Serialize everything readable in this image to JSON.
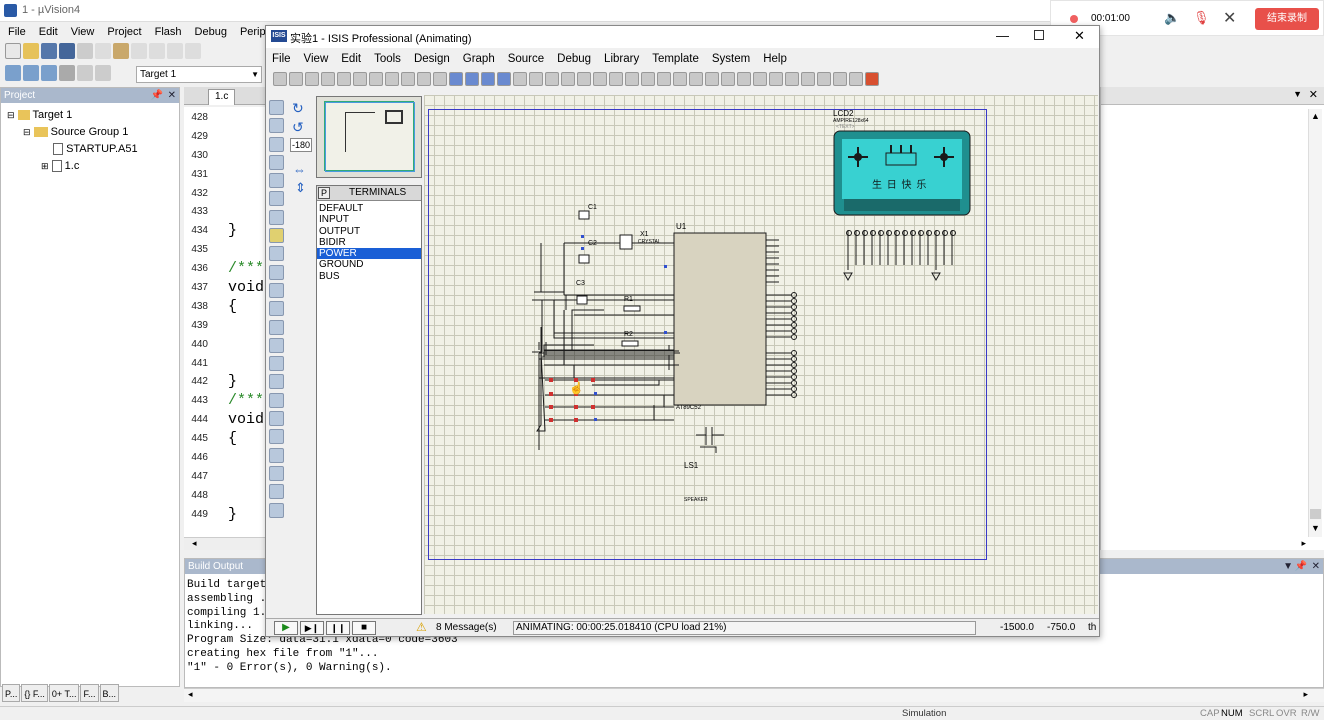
{
  "keil": {
    "title": "1 - µVision4",
    "menu": [
      "File",
      "Edit",
      "View",
      "Project",
      "Flash",
      "Debug",
      "Peripherals"
    ],
    "target_select": "Target 1",
    "project_title": "Project",
    "tree": [
      "Target 1",
      "Source Group 1",
      "STARTUP.A51",
      "1.c"
    ],
    "file_tab": "1.c",
    "line_numbers": [
      "428",
      "429",
      "430",
      "431",
      "432",
      "433",
      "434",
      "435",
      "436",
      "437",
      "438",
      "439",
      "440",
      "441",
      "442",
      "443",
      "444",
      "445",
      "446",
      "447",
      "448",
      "449"
    ],
    "code_lines": [
      "",
      "",
      "",
      "",
      "",
      "",
      "}",
      "",
      "/***",
      "void",
      "{",
      "",
      "",
      "",
      "}",
      "/***",
      "void",
      "{",
      "",
      "",
      "",
      "}"
    ],
    "build_output_title": "Build Output",
    "build_output": [
      "Build target",
      "assembling ...",
      "compiling 1.c...",
      "linking...",
      "Program Size: data=31.1 xdata=0 code=3603",
      "creating hex file from \"1\"...",
      "\"1\" - 0 Error(s), 0 Warning(s)."
    ],
    "bottom_tabs": [
      "P...",
      "{} F...",
      "0+ T...",
      "F...",
      "B..."
    ],
    "status": {
      "mode": "Simulation",
      "flags": [
        "CAP",
        "NUM",
        "SCRL",
        "OVR",
        "R/W"
      ]
    }
  },
  "recorder": {
    "time": "00:01:00",
    "end_label": "结束录制"
  },
  "isis": {
    "title": "实验1 - ISIS Professional (Animating)",
    "logo": "ISIS",
    "menu": [
      "File",
      "View",
      "Edit",
      "Tools",
      "Design",
      "Graph",
      "Source",
      "Debug",
      "Library",
      "Template",
      "System",
      "Help"
    ],
    "rotation": "-180",
    "selector_p": "P",
    "selector_title": "TERMINALS",
    "terminals": [
      "DEFAULT",
      "INPUT",
      "OUTPUT",
      "BIDIR",
      "POWER",
      "GROUND",
      "BUS"
    ],
    "selected_terminal": "POWER",
    "messages": "8 Message(s)",
    "anim_status": "ANIMATING: 00:00:25.018410 (CPU load 21%)",
    "coord_x": "-1500.0",
    "coord_y": "-750.0",
    "units": "th",
    "components": {
      "lcd": "LCD2",
      "lcd_model": "AMPIRE128x64",
      "lcd_text": "生 日 快 乐",
      "u1": "U1",
      "u1_model": "AT89C52",
      "x1": "X1",
      "x1_val": "CRYSTAL",
      "c1": "C1",
      "c2": "C2",
      "c3": "C3",
      "r1": "R1",
      "r2": "R2",
      "ls1": "LS1",
      "ls1_model": "SPEAKER",
      "text_placeholder": "<TEXT>"
    }
  }
}
